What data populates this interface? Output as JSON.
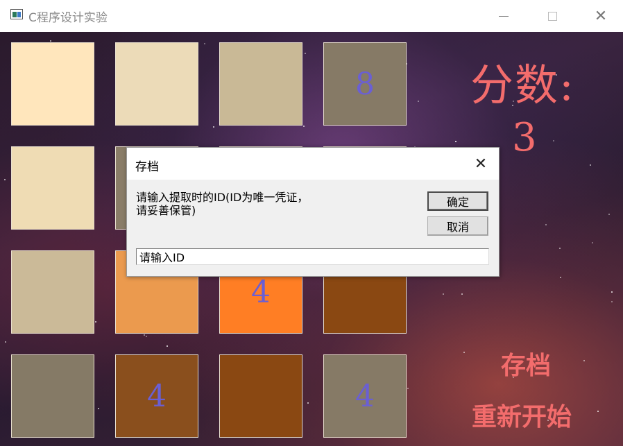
{
  "window": {
    "title": "C程序设计实验",
    "minimize_icon": "minimize-icon",
    "maximize_icon": "maximize-icon",
    "close_glyph": "✕"
  },
  "board": {
    "rows": [
      [
        {
          "value": "",
          "color": "#ffe6bc"
        },
        {
          "value": "",
          "color": "#ecdbb8"
        },
        {
          "value": "",
          "color": "#c9b996"
        },
        {
          "value": "8",
          "color": "#867a66"
        }
      ],
      [
        {
          "value": "",
          "color": "#efdcb4"
        },
        {
          "value": "",
          "color": "#8a7d68"
        },
        {
          "value": "",
          "color": "#8a7d68"
        },
        {
          "value": "",
          "color": "#8a7d68"
        }
      ],
      [
        {
          "value": "",
          "color": "#cbba98"
        },
        {
          "value": "",
          "color": "#eb9a4e"
        },
        {
          "value": "4",
          "color": "#ff7e24"
        },
        {
          "value": "",
          "color": "#8a4812"
        }
      ],
      [
        {
          "value": "",
          "color": "#857a66"
        },
        {
          "value": "4",
          "color": "#8a4f1d"
        },
        {
          "value": "",
          "color": "#8a4812"
        },
        {
          "value": "4",
          "color": "#867a66"
        }
      ]
    ],
    "number_color": "#6a5fd4"
  },
  "score": {
    "label": "分数:",
    "value": "3"
  },
  "actions": {
    "save": "存档",
    "restart": "重新开始"
  },
  "accent_color": "#f36c6c",
  "dialog": {
    "title": "存档",
    "close_glyph": "✕",
    "message_line1": "请输入提取时的ID(ID为唯一凭证，",
    "message_line2": "请妥善保管)",
    "ok_label": "确定",
    "cancel_label": "取消",
    "input_value": "请输入ID"
  }
}
